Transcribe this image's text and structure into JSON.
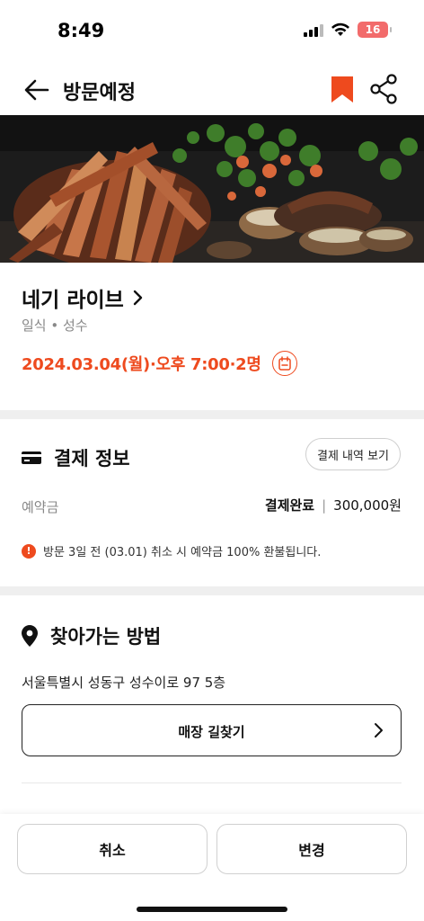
{
  "status_bar": {
    "time": "8:49",
    "battery": "16",
    "battery_color": "#f26b6b"
  },
  "header": {
    "title": "방문예정",
    "back_icon": "arrow-left-icon",
    "bookmark_icon": "bookmark-icon",
    "share_icon": "share-icon",
    "accent_color": "#ee4a1e"
  },
  "restaurant": {
    "name": "네기 라이브",
    "category": "일식 • 성수",
    "reservation": "2024.03.04(월)·오후 7:00·2명"
  },
  "payment": {
    "title": "결제 정보",
    "history_button": "결제 내역 보기",
    "deposit_label": "예약금",
    "deposit_status": "결제완료",
    "deposit_separator": "|",
    "deposit_amount": "300,000원",
    "refund_note": "방문 3일 전 (03.01) 취소 시 예약금 100% 환불됩니다.",
    "info_icon_glyph": "!"
  },
  "directions": {
    "title": "찾아가는 방법",
    "address": "서울특별시 성동구 성수이로 97 5층",
    "store_directions_button": "매장 길찾기"
  },
  "bottom": {
    "cancel_label": "취소",
    "change_label": "변경"
  }
}
